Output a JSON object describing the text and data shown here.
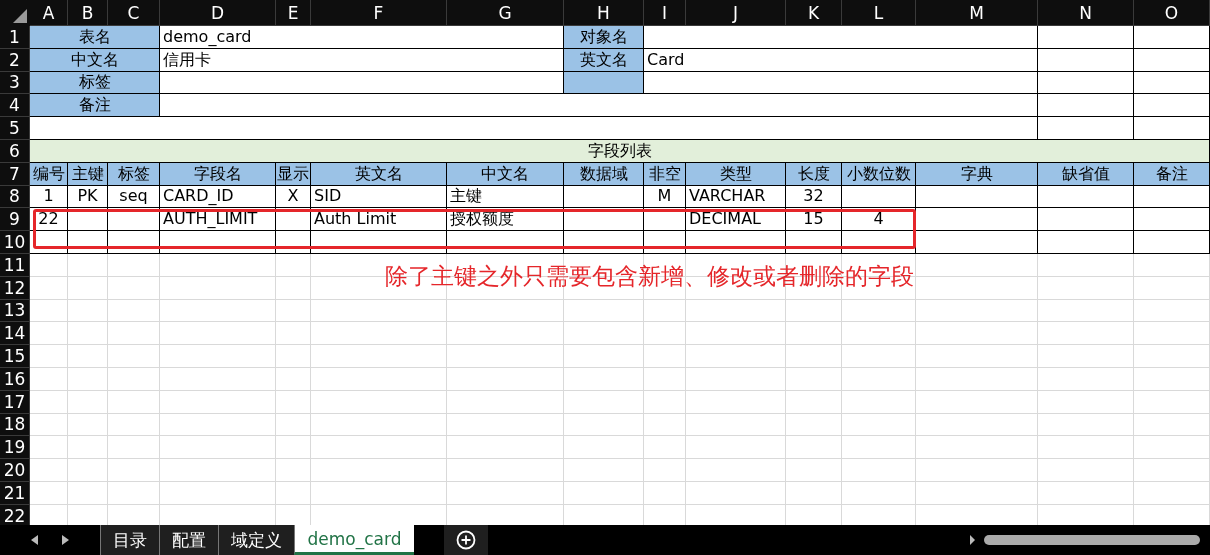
{
  "column_headers": [
    "A",
    "B",
    "C",
    "D",
    "E",
    "F",
    "G",
    "H",
    "I",
    "J",
    "K",
    "L",
    "M",
    "N",
    "O"
  ],
  "row_headers": [
    "1",
    "2",
    "3",
    "4",
    "5",
    "6",
    "7",
    "8",
    "9",
    "10",
    "11",
    "12",
    "13",
    "14",
    "15",
    "16",
    "17",
    "18",
    "19",
    "20",
    "21",
    "22"
  ],
  "info_rows": [
    {
      "kind": "pair",
      "label": "表名",
      "value": "demo_card",
      "side_label": "对象名"
    },
    {
      "kind": "pair",
      "label": "中文名",
      "value": "信用卡",
      "side_label": "英文名",
      "side_value": "Card"
    },
    {
      "kind": "pair",
      "label": "标签"
    },
    {
      "kind": "single",
      "label": "备注"
    }
  ],
  "section_title": "字段列表",
  "field_table": {
    "columns": [
      "编号",
      "主键",
      "标签",
      "字段名",
      "显示",
      "英文名",
      "中文名",
      "数据域",
      "非空",
      "类型",
      "长度",
      "小数位数",
      "字典",
      "缺省值",
      "备注"
    ],
    "rows": [
      {
        "highlighted": false,
        "cells": {
          "A": "1",
          "B": "PK",
          "C": "seq",
          "D": "CARD_ID",
          "E": "X",
          "F": "SID",
          "G": "主键",
          "I": "M",
          "J": "VARCHAR",
          "K": "32"
        }
      },
      {
        "highlighted": true,
        "cells": {
          "A": "22",
          "D": "AUTH_LIMIT",
          "F": "Auth Limit",
          "G": "授权额度",
          "J": "DECIMAL",
          "K": "15",
          "L": "4"
        }
      }
    ]
  },
  "annotation": "除了主键之外只需要包含新增、修改或者删除的字段",
  "sheet_tabs": [
    {
      "label": "目录",
      "selected": false
    },
    {
      "label": "配置",
      "selected": false
    },
    {
      "label": "域定义",
      "selected": false
    },
    {
      "label": "demo_card",
      "selected": true
    }
  ]
}
